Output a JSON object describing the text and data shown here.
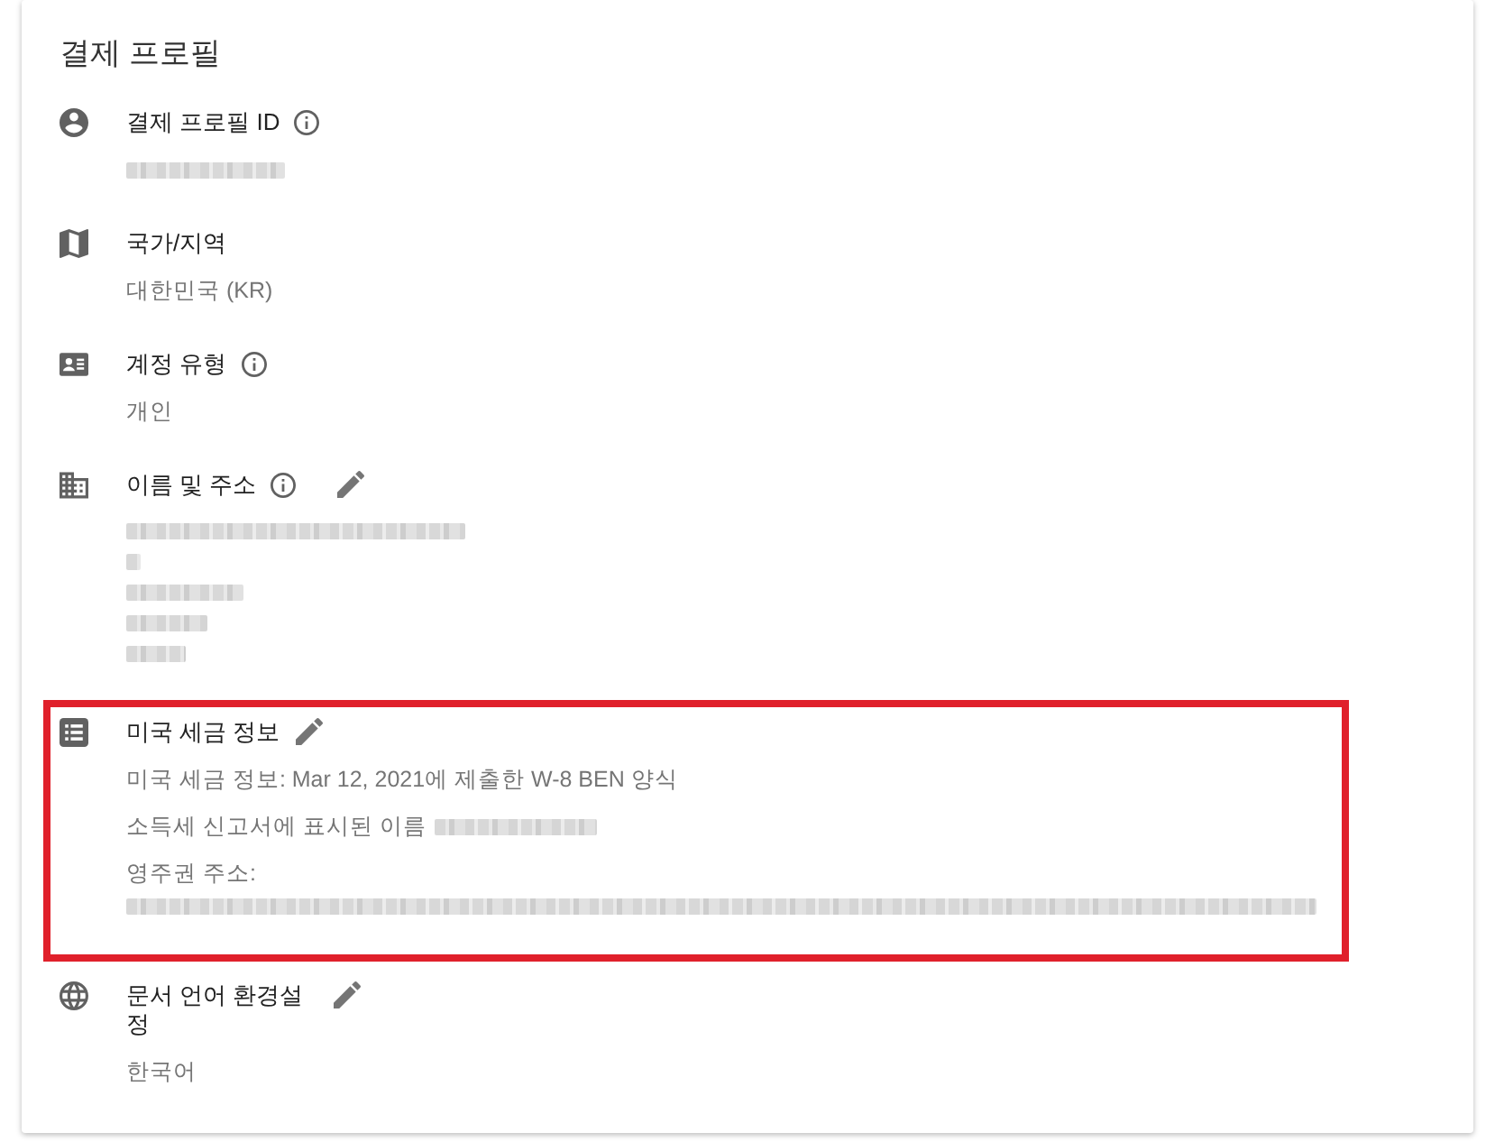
{
  "title": "결제 프로필",
  "sections": [
    {
      "label": "결제 프로필 ID",
      "info": true,
      "editable": false,
      "highlighted": false,
      "values": [
        {
          "kind": "redacted"
        }
      ]
    },
    {
      "label": "국가/지역",
      "info": false,
      "editable": false,
      "highlighted": false,
      "values": [
        {
          "kind": "text",
          "text": "대한민국 (KR)"
        }
      ]
    },
    {
      "label": "계정 유형",
      "info": true,
      "editable": false,
      "highlighted": false,
      "values": [
        {
          "kind": "text",
          "text": "개인"
        }
      ]
    },
    {
      "label": "이름 및 주소",
      "info": true,
      "editable": true,
      "highlighted": false,
      "values": [
        {
          "kind": "address",
          "lines": [
            {
              "kind": "redacted"
            },
            {
              "kind": "redacted"
            },
            {
              "kind": "redacted"
            },
            {
              "kind": "redacted"
            },
            {
              "kind": "redacted"
            }
          ]
        }
      ]
    },
    {
      "label": "미국 세금 정보",
      "info": false,
      "editable": true,
      "highlighted": true,
      "values": [
        {
          "kind": "text",
          "text": "미국 세금 정보: Mar 12, 2021에 제출한 W-8 BEN 양식"
        },
        {
          "kind": "text_redacted",
          "text": "소득세 신고서에 표시된 이름"
        },
        {
          "kind": "address",
          "text": "영주권 주소:",
          "lines": [
            {
              "kind": "redacted"
            }
          ]
        }
      ]
    },
    {
      "label": "문서 언어 환경설정",
      "info": false,
      "editable": true,
      "highlighted": false,
      "values": [
        {
          "kind": "text",
          "text": "한국어"
        }
      ]
    }
  ]
}
